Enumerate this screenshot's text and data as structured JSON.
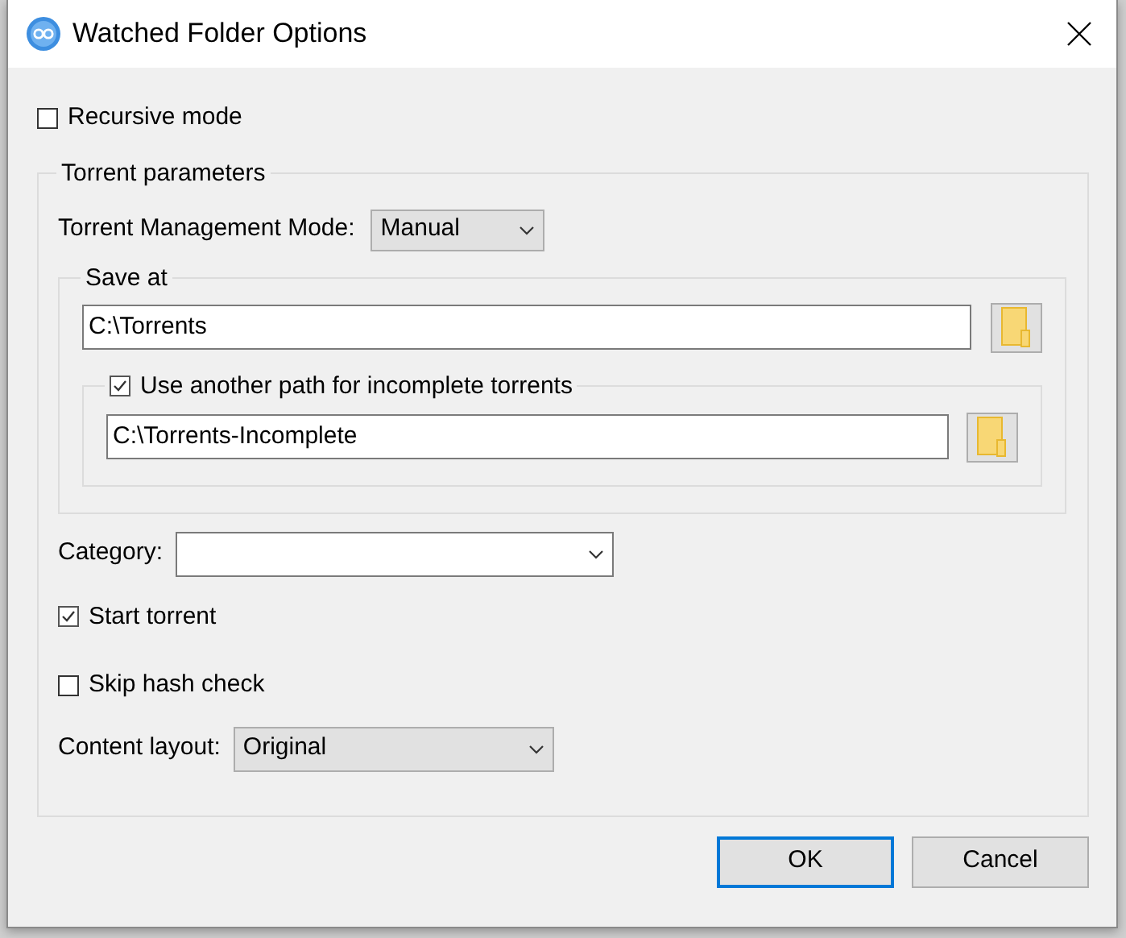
{
  "window": {
    "title": "Watched Folder Options"
  },
  "recursive_mode": {
    "label": "Recursive mode",
    "checked": false
  },
  "torrent_parameters": {
    "title": "Torrent parameters",
    "management_mode": {
      "label": "Torrent Management Mode:",
      "value": "Manual"
    },
    "save_at": {
      "title": "Save at",
      "path": "C:\\Torrents",
      "incomplete": {
        "label": "Use another path for incomplete torrents",
        "checked": true,
        "path": "C:\\Torrents-Incomplete"
      }
    },
    "category": {
      "label": "Category:"
    },
    "start_torrent": {
      "label": "Start torrent",
      "checked": true
    },
    "skip_hash_check": {
      "label": "Skip hash check",
      "checked": false
    },
    "content_layout": {
      "label": "Content layout:",
      "value": "Original"
    }
  },
  "buttons": [
    {
      "label": "OK",
      "default": true
    },
    {
      "label": "Cancel",
      "default": false
    }
  ]
}
